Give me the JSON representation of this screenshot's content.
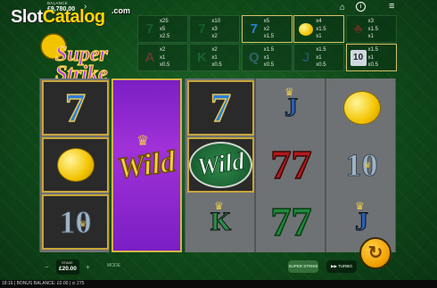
{
  "balance": {
    "label": "BALANCE",
    "value": "£9,780.00"
  },
  "header": {
    "chevron": "›",
    "home_icon": "⌂",
    "info_icon": "i",
    "menu_icon": "≡"
  },
  "watermark": {
    "prefix": "Slot",
    "highlight": "Catalog",
    "suffix": ".com"
  },
  "game_logo": {
    "line1": "Super",
    "line2": "Strike"
  },
  "paytable": [
    {
      "symbol": "seven-green",
      "glyph": "7",
      "pays": [
        "x25",
        "x5",
        "x2.5"
      ],
      "highlighted": false
    },
    {
      "symbol": "seven-green",
      "glyph": "7",
      "pays": [
        "x10",
        "x3",
        "x2"
      ],
      "highlighted": false
    },
    {
      "symbol": "seven-blue",
      "glyph": "7",
      "pays": [
        "x5",
        "x2",
        "x1.5"
      ],
      "highlighted": true
    },
    {
      "symbol": "lemon",
      "glyph": "",
      "pays": [
        "x4",
        "x1.5",
        "x1"
      ],
      "highlighted": true
    },
    {
      "symbol": "cherry",
      "glyph": "♣",
      "pays": [
        "x3",
        "x1.5",
        "x1"
      ],
      "highlighted": false
    },
    {
      "symbol": "letter-A",
      "glyph": "A",
      "pays": [
        "x2",
        "x1",
        "x0.5"
      ],
      "highlighted": false
    },
    {
      "symbol": "letter-K",
      "glyph": "K",
      "pays": [
        "x2",
        "x1",
        "x0.5"
      ],
      "highlighted": false
    },
    {
      "symbol": "letter-Q",
      "glyph": "Q",
      "pays": [
        "x1.5",
        "x1",
        "x0.5"
      ],
      "highlighted": false
    },
    {
      "symbol": "letter-J",
      "glyph": "J",
      "pays": [
        "x1.5",
        "x1",
        "x0.5"
      ],
      "highlighted": false
    },
    {
      "symbol": "ten",
      "glyph": "10",
      "pays": [
        "x1.5",
        "x1",
        "x0.5"
      ],
      "highlighted": true
    }
  ],
  "reels": [
    [
      {
        "type": "seven-blue",
        "glyph": "7",
        "win": true
      },
      {
        "type": "lemon",
        "glyph": "",
        "win": true
      },
      {
        "type": "ten",
        "glyph": "10",
        "win": true
      }
    ],
    [
      {
        "type": "wild-purple",
        "glyph": "Wild"
      }
    ],
    [
      {
        "type": "seven-blue",
        "glyph": "7",
        "win": true
      },
      {
        "type": "wild-green",
        "glyph": "Wild",
        "win": true
      },
      {
        "type": "letter",
        "glyph": "K",
        "win": false
      }
    ],
    [
      {
        "type": "letter",
        "glyph": "J",
        "win": false
      },
      {
        "type": "seven-red",
        "glyph": "77",
        "win": false
      },
      {
        "type": "seven-green",
        "glyph": "77",
        "win": false
      }
    ],
    [
      {
        "type": "lemon",
        "glyph": "",
        "win": false
      },
      {
        "type": "ten",
        "glyph": "10",
        "win": false
      },
      {
        "type": "letter",
        "glyph": "J",
        "win": false
      }
    ]
  ],
  "controls": {
    "stake_label": "STAKE",
    "stake_value": "£20.00",
    "minus": "−",
    "plus": "+",
    "mode_label": "MODE",
    "logo_small": "SUPER STRIKE",
    "turbo_label": "▶▶ TURBO",
    "spin_icon": "↻"
  },
  "status": {
    "text": "18:16 | BONUS BALANCE: £0.00 | ⊙ 275"
  },
  "colors": {
    "felt": "#0f4a19",
    "win_border": "#c8a53a",
    "spin": "#f0a000",
    "wild_purple": "#a031d8"
  }
}
